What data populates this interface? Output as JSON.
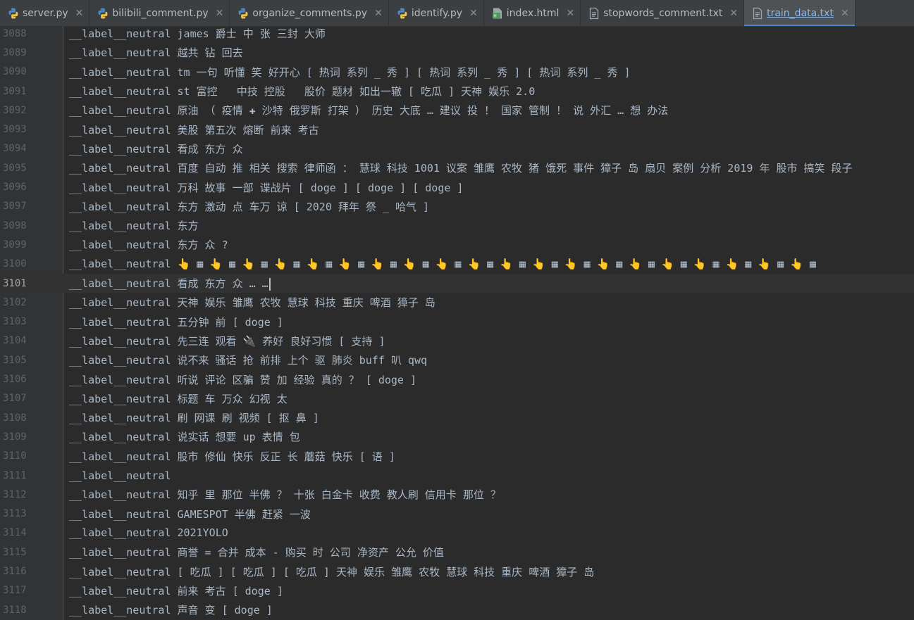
{
  "tabs": [
    {
      "label": "server.py",
      "icon": "python-file-icon",
      "active": false
    },
    {
      "label": "bilibili_comment.py",
      "icon": "python-file-icon",
      "active": false
    },
    {
      "label": "organize_comments.py",
      "icon": "python-file-icon",
      "active": false
    },
    {
      "label": "identify.py",
      "icon": "python-file-icon",
      "active": false
    },
    {
      "label": "index.html",
      "icon": "html-file-icon",
      "active": false
    },
    {
      "label": "stopwords_comment.txt",
      "icon": "text-file-icon",
      "active": false
    },
    {
      "label": "train_data.txt",
      "icon": "text-file-icon",
      "active": true
    }
  ],
  "editor": {
    "current_line": "3101",
    "lines": [
      {
        "num": "3088",
        "text": "__label__neutral james 爵士 中 张 三封 大师"
      },
      {
        "num": "3089",
        "text": "__label__neutral 越共 钻 回去"
      },
      {
        "num": "3090",
        "text": "__label__neutral tm 一句 听懂 笑 好开心 [ 热词 系列 _ 秀 ] [ 热词 系列 _ 秀 ] [ 热词 系列 _ 秀 ]"
      },
      {
        "num": "3091",
        "text": "__label__neutral st 富控   中技 控股   股价 题材 如出一辙 [ 吃瓜 ] 天神 娱乐 2.0"
      },
      {
        "num": "3092",
        "text": "__label__neutral 原油 （ 疫情 ✚ 沙特 俄罗斯 打架 ） 历史 大底 … 建议 投 ！ 国家 管制 ！ 说 外汇 … 想 办法"
      },
      {
        "num": "3093",
        "text": "__label__neutral 美股 第五次 熔断 前来 考古"
      },
      {
        "num": "3094",
        "text": "__label__neutral 看成 东方 众"
      },
      {
        "num": "3095",
        "text": "__label__neutral 百度 自动 推 相关 搜索 律师函 ： 慧球 科技 1001 议案 雏鹰 农牧 猪 饿死 事件 獐子 岛 扇贝 案例 分析 2019 年 股市 搞笑 段子"
      },
      {
        "num": "3096",
        "text": "__label__neutral 万科 故事 一部 谍战片 [ doge ] [ doge ] [ doge ]"
      },
      {
        "num": "3097",
        "text": "__label__neutral 东方 激动 点 车万 谅 [ 2020 拜年 祭 _ 哈气 ]"
      },
      {
        "num": "3098",
        "text": "__label__neutral 东方"
      },
      {
        "num": "3099",
        "text": "__label__neutral 东方 众 ?"
      },
      {
        "num": "3100",
        "text": "__label__neutral 👆 ▦ 👆 ▦ 👆 ▦ 👆 ▦ 👆 ▦ 👆 ▦ 👆 ▦ 👆 ▦ 👆 ▦ 👆 ▦ 👆 ▦ 👆 ▦ 👆 ▦ 👆 ▦ 👆 ▦ 👆 ▦ 👆 ▦ 👆 ▦ 👆 ▦ 👆 ▦"
      },
      {
        "num": "3101",
        "text": "__label__neutral 看成 东方 众 … …"
      },
      {
        "num": "3102",
        "text": "__label__neutral 天神 娱乐 雏鹰 农牧 慧球 科技 重庆 啤酒 獐子 岛"
      },
      {
        "num": "3103",
        "text": "__label__neutral 五分钟 前 [ doge ]"
      },
      {
        "num": "3104",
        "text": "__label__neutral 先三连 观看 🔌 养好 良好习惯 [ 支持 ]"
      },
      {
        "num": "3105",
        "text": "__label__neutral 说不来 骚话 抢 前排 上个 驱 肺炎 buff 叭 qwq"
      },
      {
        "num": "3106",
        "text": "__label__neutral 听说 评论 区骗 赞 加 经验 真的 ？ [ doge ]"
      },
      {
        "num": "3107",
        "text": "__label__neutral 标题 车 万众 幻视 太"
      },
      {
        "num": "3108",
        "text": "__label__neutral 刷 网课 刷 视频 [ 抠 鼻 ]"
      },
      {
        "num": "3109",
        "text": "__label__neutral 说实话 想要 up 表情 包"
      },
      {
        "num": "3110",
        "text": "__label__neutral 股市 修仙 快乐 反正 长 蘑菇 快乐 [ 语 ]"
      },
      {
        "num": "3111",
        "text": "__label__neutral"
      },
      {
        "num": "3112",
        "text": "__label__neutral 知乎 里 那位 半佛 ？ 十张 白金卡 收费 教人刷 信用卡 那位 ？"
      },
      {
        "num": "3113",
        "text": "__label__neutral GAMESPOT 半佛 赶紧 一波"
      },
      {
        "num": "3114",
        "text": "__label__neutral 2021YOLO"
      },
      {
        "num": "3115",
        "text": "__label__neutral 商誉 = 合并 成本 - 购买 时 公司 净资产 公允 价值"
      },
      {
        "num": "3116",
        "text": "__label__neutral [ 吃瓜 ] [ 吃瓜 ] [ 吃瓜 ] 天神 娱乐 雏鹰 农牧 慧球 科技 重庆 啤酒 獐子 岛"
      },
      {
        "num": "3117",
        "text": "__label__neutral 前来 考古 [ doge ]"
      },
      {
        "num": "3118",
        "text": "__label__neutral 声音 变 [ doge ]"
      }
    ]
  },
  "colors": {
    "background": "#2b2b2b",
    "gutter": "#313335",
    "text": "#a9b7c6",
    "line_number": "#606366",
    "active_tab_underline": "#4a88c7"
  }
}
